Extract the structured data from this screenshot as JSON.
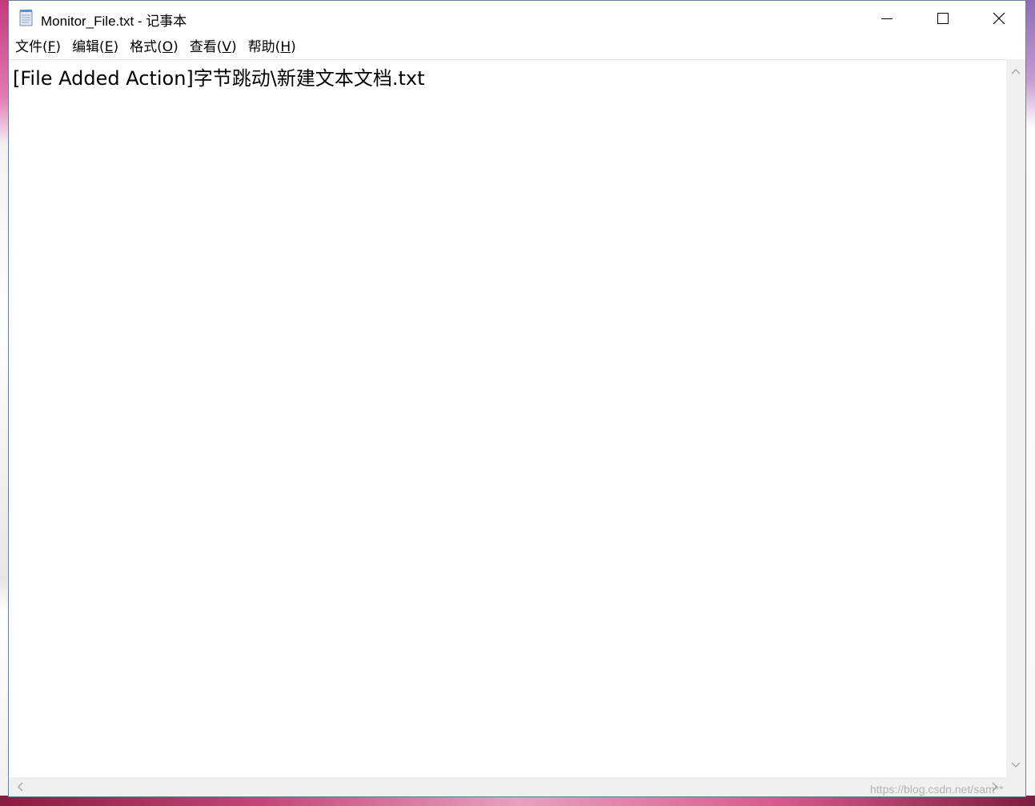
{
  "window": {
    "title": "Monitor_File.txt - 记事本"
  },
  "menu": [
    {
      "label": "文件(",
      "key": "F",
      "end": ")"
    },
    {
      "label": "编辑(",
      "key": "E",
      "end": ")"
    },
    {
      "label": "格式(",
      "key": "O",
      "end": ")"
    },
    {
      "label": "查看(",
      "key": "V",
      "end": ")"
    },
    {
      "label": "帮助(",
      "key": "H",
      "end": ")"
    }
  ],
  "editor": {
    "content": "[File Added Action]字节跳动\\新建文本文档.txt"
  },
  "watermark": "https://blog.csdn.net/sam**"
}
